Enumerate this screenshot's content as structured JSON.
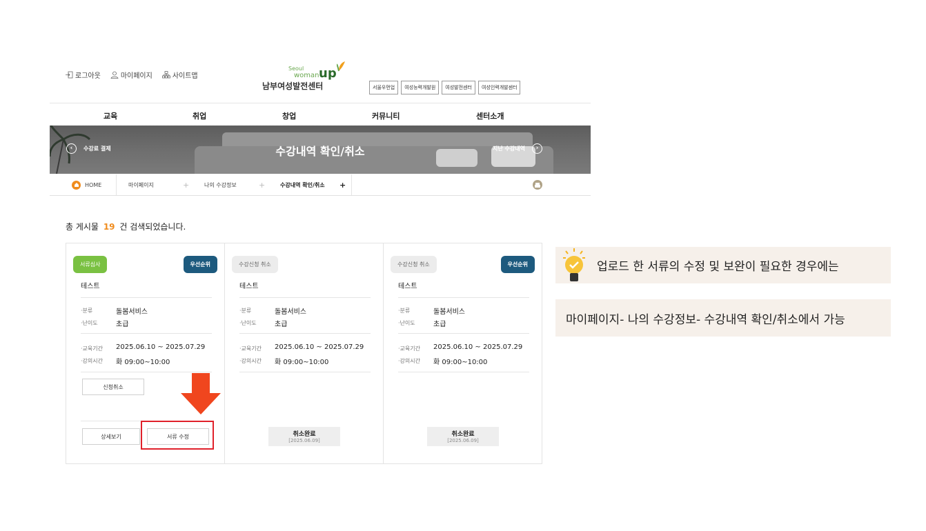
{
  "util": {
    "logout": "로그아웃",
    "mypage": "마이페이지",
    "sitemap": "사이트맵"
  },
  "logo": {
    "line1": "Seoul",
    "line2": "woman",
    "up": "up",
    "name": "남부여성발전센터"
  },
  "family_sites": [
    "서울우먼업",
    "여성능력개발원",
    "여성발전센터",
    "여성인력개발센터"
  ],
  "gnb": [
    "교육",
    "취업",
    "창업",
    "커뮤니티",
    "센터소개"
  ],
  "banner": {
    "title": "수강내역 확인/취소",
    "prev": "수강료 결제",
    "next": "지난 수강내역"
  },
  "breadcrumb": {
    "home": "HOME",
    "l1": "마이페이지",
    "l2": "나의 수강정보",
    "l3": "수강내역 확인/취소",
    "sep": "+",
    "current_mark": "+"
  },
  "total": {
    "prefix": "총 게시물",
    "count": "19",
    "suffix": "건 검색되었습니다."
  },
  "cards": [
    {
      "badge": "서류심사",
      "priority": "우선순위",
      "title": "테스트",
      "type_k": "분류",
      "type_v": "돌봄서비스",
      "level_k": "난이도",
      "level_v": "초급",
      "period_k": "교육기간",
      "period_v": "2025.06.10 ~ 2025.07.29",
      "time_k": "강의시간",
      "time_v": "화 09:00~10:00",
      "cancel_btn": "신청취소",
      "detail_btn": "상세보기",
      "doc_btn": "서류 수정"
    },
    {
      "badge": "수강신청 취소",
      "title": "테스트",
      "type_k": "분류",
      "type_v": "돌봄서비스",
      "level_k": "난이도",
      "level_v": "초급",
      "period_k": "교육기간",
      "period_v": "2025.06.10 ~ 2025.07.29",
      "time_k": "강의시간",
      "time_v": "화 09:00~10:00",
      "done": "취소완료",
      "done_date": "[2025.06.09]"
    },
    {
      "badge": "수강신청 취소",
      "priority": "우선순위",
      "title": "테스트",
      "type_k": "분류",
      "type_v": "돌봄서비스",
      "level_k": "난이도",
      "level_v": "초급",
      "period_k": "교육기간",
      "period_v": "2025.06.10 ~ 2025.07.29",
      "time_k": "강의시간",
      "time_v": "화 09:00~10:00",
      "done": "취소완료",
      "done_date": "[2025.06.09]"
    }
  ],
  "tips": {
    "line1": "업로드 한 서류의 수정 및 보완이 필요한 경우에는",
    "line2": "마이페이지- 나의 수강정보- 수강내역 확인/취소에서 가능"
  },
  "colors": {
    "accent_orange": "#f08c1e",
    "priority_blue": "#1d5a7e",
    "badge_green": "#7ac142",
    "highlight_red": "#e0202a",
    "arrow_orange": "#f0461e",
    "tip_bg": "#f6f0ea"
  }
}
